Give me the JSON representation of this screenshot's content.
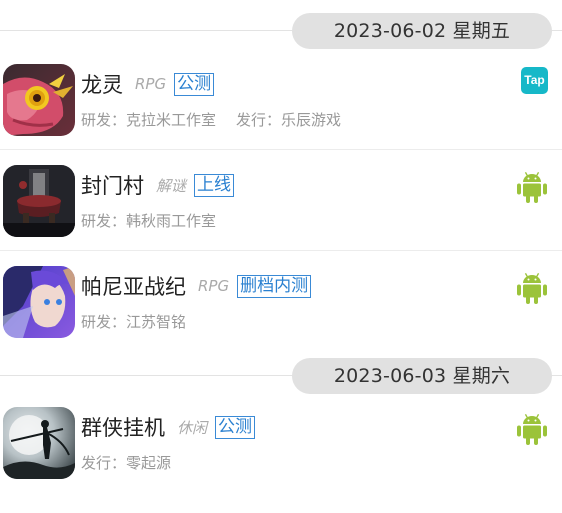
{
  "sections": [
    {
      "date": "2023-06-02 星期五",
      "games": [
        {
          "title": "龙灵",
          "genre": "RPG",
          "status": "公测",
          "meta": [
            "研发：克拉米工作室",
            "发行：乐辰游戏"
          ],
          "platform": "tap",
          "platform_label": "Tap",
          "icon": "dragon-bird-icon"
        },
        {
          "title": "封门村",
          "genre": "解谜",
          "status": "上线",
          "meta": [
            "研发：韩秋雨工作室"
          ],
          "platform": "android",
          "icon": "haunted-cauldron-icon"
        },
        {
          "title": "帕尼亚战纪",
          "genre": "RPG",
          "status": "删档内测",
          "meta": [
            "研发：江苏智铭"
          ],
          "platform": "android",
          "icon": "anime-warrior-icon"
        }
      ]
    },
    {
      "date": "2023-06-03 星期六",
      "games": [
        {
          "title": "群侠挂机",
          "genre": "休闲",
          "status": "公测",
          "meta": [
            "发行：零起源"
          ],
          "platform": "android",
          "icon": "moon-swordsman-icon"
        }
      ]
    }
  ],
  "colors": {
    "status_blue": "#2a80d0",
    "android_green": "#9bc33a",
    "tap_teal": "#16b8c8",
    "date_pill": "#e1e1e1"
  }
}
